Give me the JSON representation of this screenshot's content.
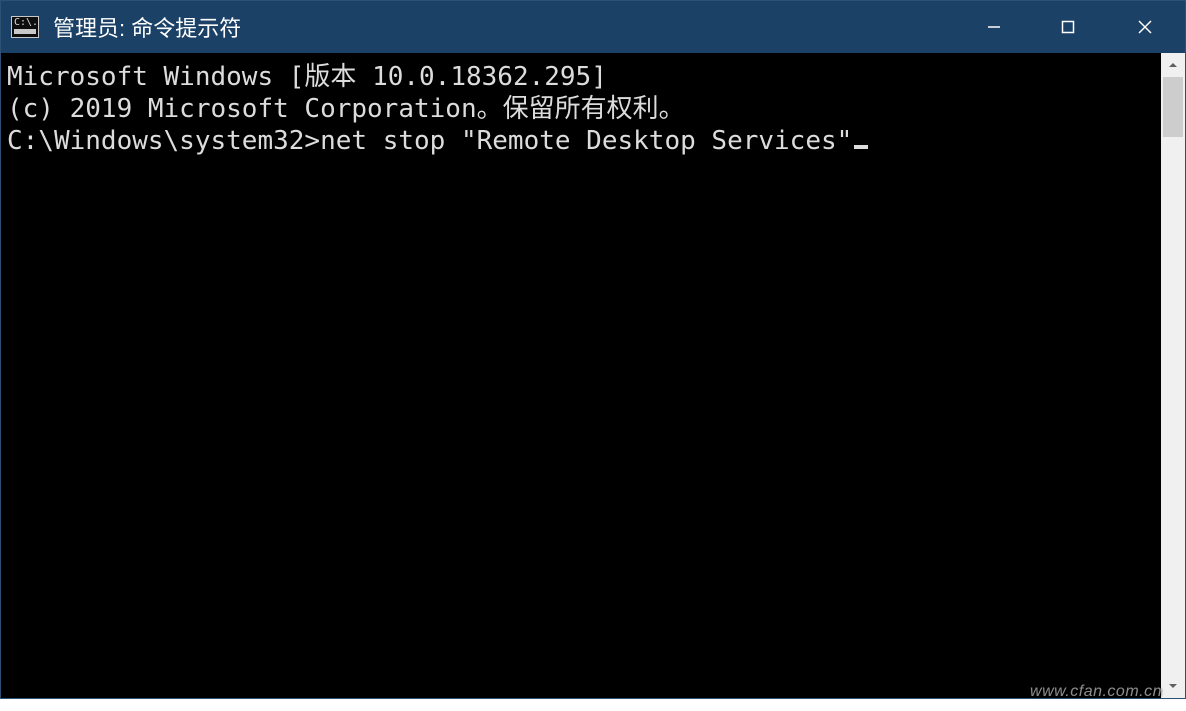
{
  "titlebar": {
    "icon_text": "C:\\.",
    "title": "管理员: 命令提示符"
  },
  "terminal": {
    "line1": "Microsoft Windows [版本 10.0.18362.295]",
    "line2": "(c) 2019 Microsoft Corporation。保留所有权利。",
    "blank": "",
    "prompt": "C:\\Windows\\system32>",
    "command": "net stop \"Remote Desktop Services\""
  },
  "watermark": "www.cfan.com.cn"
}
